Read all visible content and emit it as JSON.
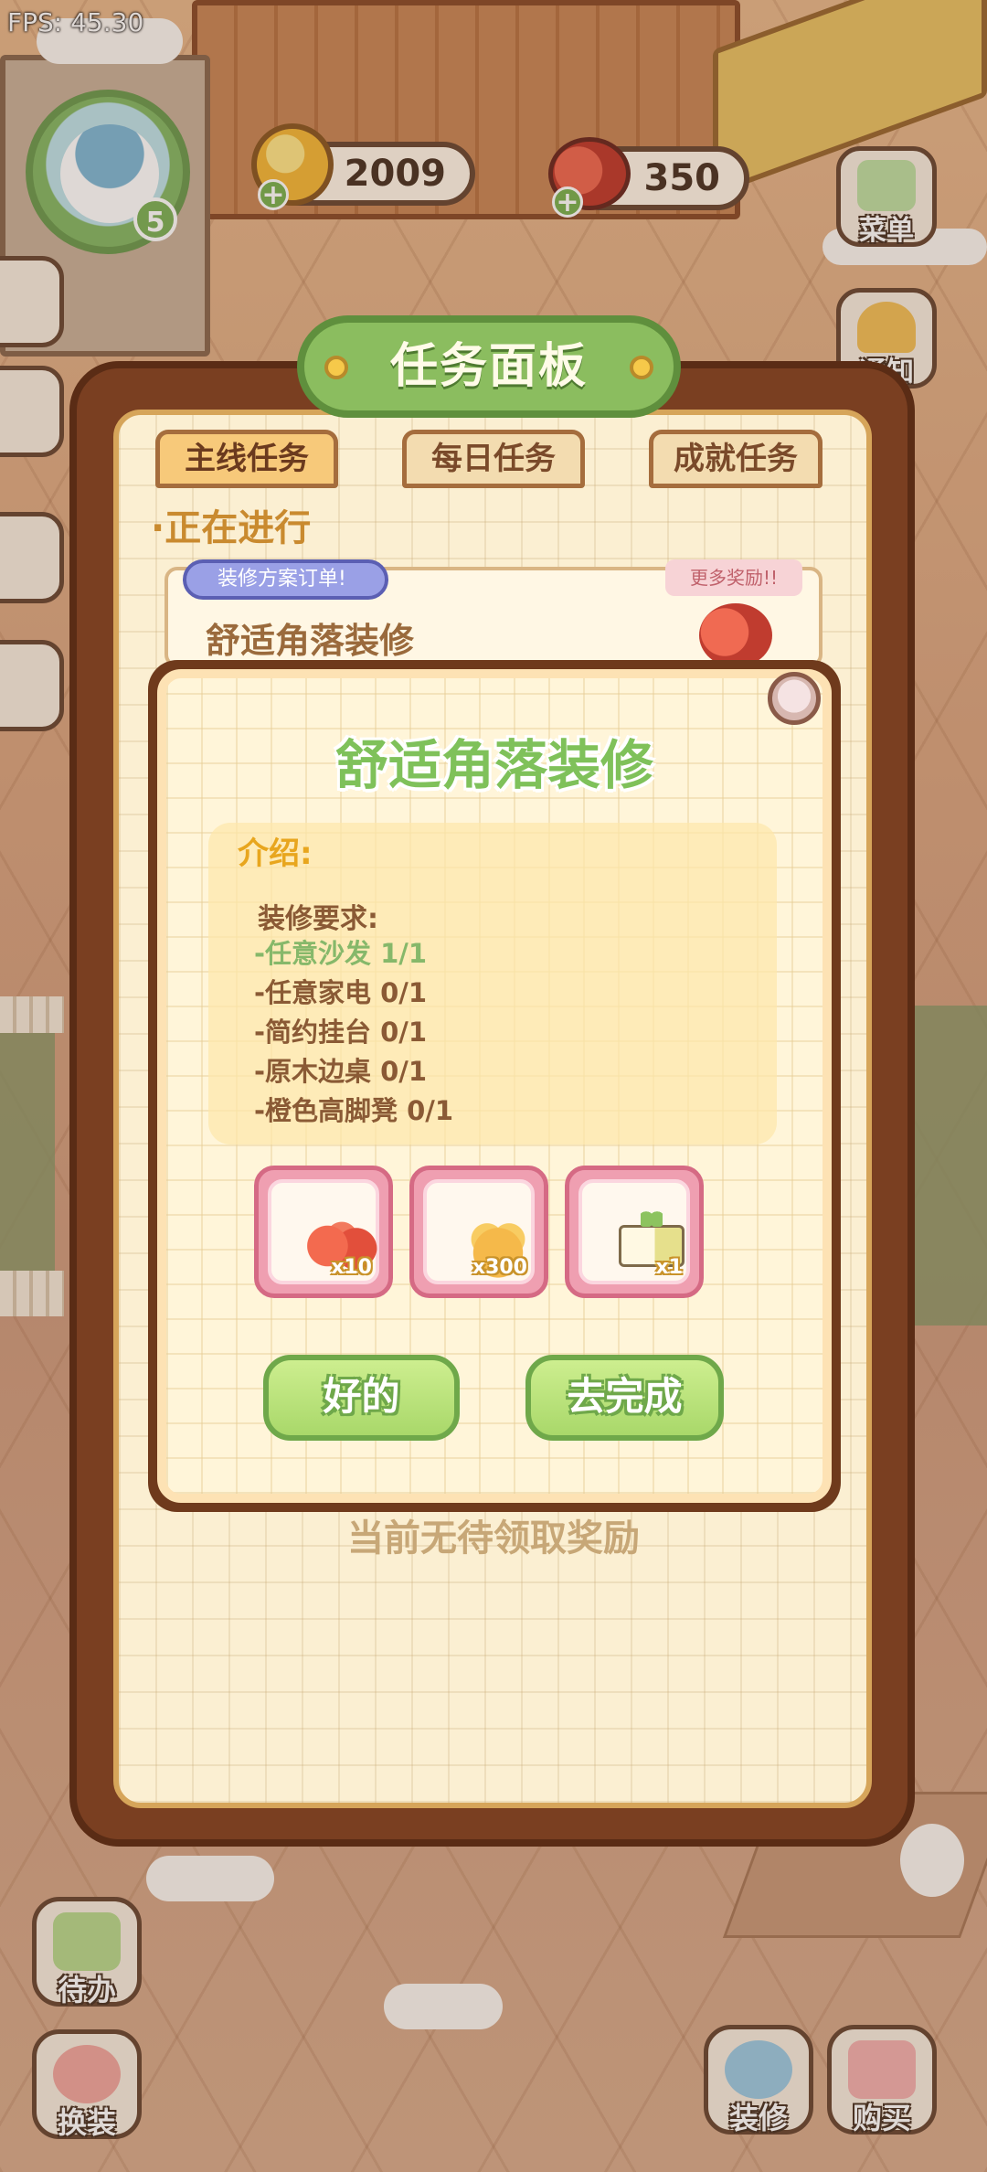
{
  "fps": "FPS: 45.30",
  "player": {
    "level": "5"
  },
  "resources": {
    "coins": "2009",
    "cherries": "350"
  },
  "side_buttons": {
    "menu": "菜单",
    "notice": "通知"
  },
  "bottom_buttons": {
    "todo": "待办",
    "outfit": "换装",
    "decorate": "装修",
    "shop": "购买"
  },
  "panel": {
    "title": "任务面板",
    "tabs": [
      "主线任务",
      "每日任务",
      "成就任务"
    ],
    "active_tab": 0,
    "section_ongoing": "·正在进行",
    "order_badge": "装修方案订单!",
    "order_name": "舒适角落装修",
    "more_rewards": "更多奖励!!",
    "no_reward_text": "当前无待领取奖励"
  },
  "modal": {
    "title": "舒适角落装修",
    "intro_label": "介绍:",
    "requirements_title": "装修要求:",
    "requirements": [
      {
        "text": "-任意沙发 1/1",
        "done": true
      },
      {
        "text": "-任意家电 0/1",
        "done": false
      },
      {
        "text": "-简约挂台 0/1",
        "done": false
      },
      {
        "text": "-原木边桌 0/1",
        "done": false
      },
      {
        "text": "-橙色高脚凳 0/1",
        "done": false
      }
    ],
    "rewards": [
      {
        "icon": "cherry-icon",
        "count": "x10"
      },
      {
        "icon": "coin-pile-icon",
        "count": "x300"
      },
      {
        "icon": "furniture-box-icon",
        "count": "x1"
      }
    ],
    "ok_button": "好的",
    "go_button": "去完成"
  }
}
